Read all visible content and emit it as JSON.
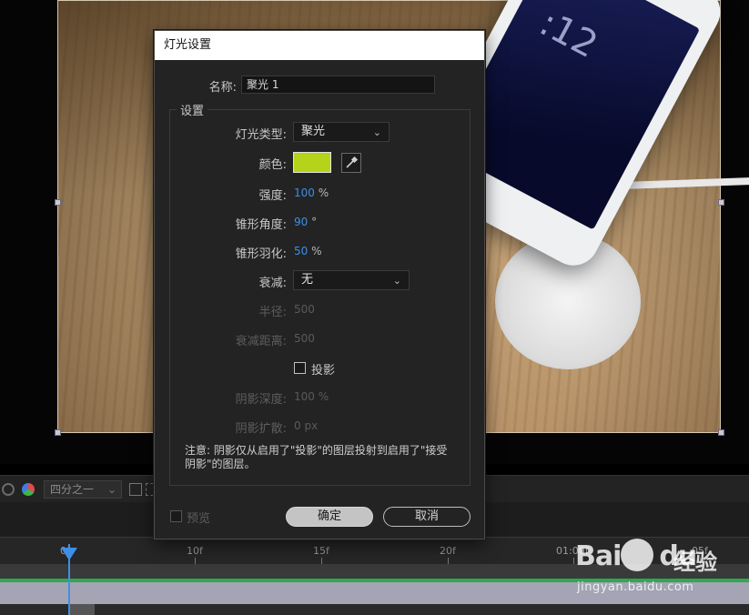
{
  "timeline": {
    "resolution_select": "四分之一",
    "ruler_ticks": [
      "0f",
      "10f",
      "15f",
      "20f",
      "01:00f",
      "05f"
    ],
    "colors": {
      "playhead": "#3f8fe6",
      "track_line": "#2fa84f"
    }
  },
  "watermark": {
    "logo_text": "Bai",
    "logo_text_2": "du",
    "cn_text": "经验",
    "url": "jingyan.baidu.com"
  },
  "dialog": {
    "title": "灯光设置",
    "name_label": "名称:",
    "name_value": "聚光 1",
    "settings_group_label": "设置",
    "light_type": {
      "label": "灯光类型:",
      "value": "聚光"
    },
    "color": {
      "label": "颜色:",
      "value": "#b5d31a"
    },
    "intensity": {
      "label": "强度:",
      "value": "100",
      "unit": "%"
    },
    "cone_angle": {
      "label": "锥形角度:",
      "value": "90",
      "unit": "°"
    },
    "cone_feather": {
      "label": "锥形羽化:",
      "value": "50",
      "unit": "%"
    },
    "falloff": {
      "label": "衰减:",
      "value": "无"
    },
    "radius": {
      "label": "半径:",
      "value": "500"
    },
    "falloff_distance": {
      "label": "衰减距离:",
      "value": "500"
    },
    "casts_shadows": {
      "label": "投影",
      "checked": false
    },
    "shadow_darkness": {
      "label": "阴影深度:",
      "value": "100",
      "unit": "%"
    },
    "shadow_diffusion": {
      "label": "阴影扩散:",
      "value": "0",
      "unit": "px"
    },
    "note": "注意: 阴影仅从启用了\"投影\"的图层投射到启用了\"接受阴影\"的图层。",
    "preview_label": "预览",
    "ok_label": "确定",
    "cancel_label": "取消"
  }
}
